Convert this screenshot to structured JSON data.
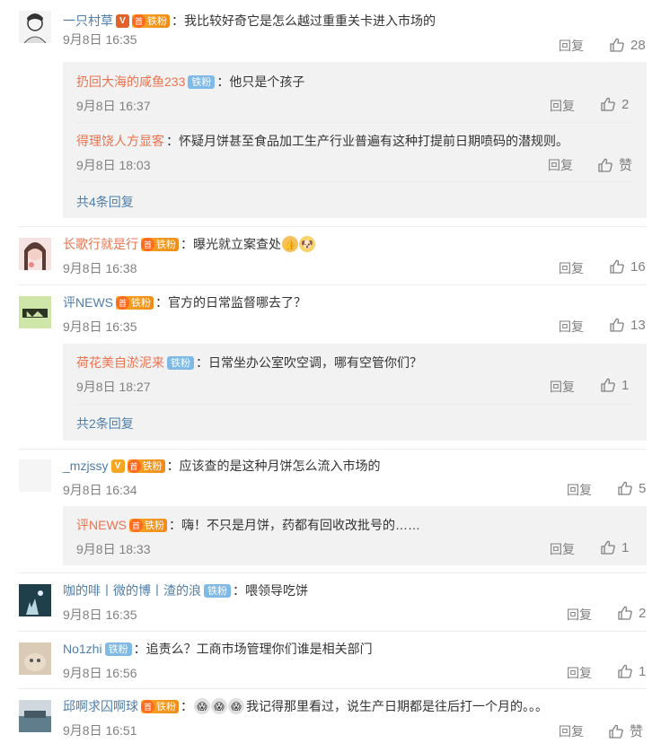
{
  "comments": [
    {
      "user": "一只村草",
      "text": "：我比较好奇它是怎么越过重重关卡进入市场的",
      "time": "9月8日 16:35",
      "reply": "回复",
      "likes": "28",
      "replies": [
        {
          "user": "扔回大海的咸鱼233",
          "badge": "铁粉",
          "text": "：他只是个孩子",
          "time": "9月8日 16:37",
          "reply": "回复",
          "likes": "2"
        },
        {
          "user": "得理饶人方显客",
          "text": "：怀疑月饼甚至食品加工生产行业普遍有这种打提前日期喷码的潜规则。",
          "time": "9月8日 18:03",
          "reply": "回复",
          "likes": "赞"
        }
      ],
      "more": "共4条回复"
    },
    {
      "user": "长歌行就是行",
      "text": "：曝光就立案查处",
      "time": "9月8日 16:38",
      "reply": "回复",
      "likes": "16"
    },
    {
      "user": "评NEWS",
      "text": "：官方的日常监督哪去了？",
      "time": "9月8日 16:35",
      "reply": "回复",
      "likes": "13",
      "replies": [
        {
          "user": "荷花美自淤泥来",
          "badge": "铁粉",
          "text": "：日常坐办公室吹空调，哪有空管你们？",
          "time": "9月8日 18:27",
          "reply": "回复",
          "likes": "1"
        }
      ],
      "more": "共2条回复"
    },
    {
      "user": "_mzjssy",
      "text": "：应该查的是这种月饼怎么流入市场的",
      "time": "9月8日 16:34",
      "reply": "回复",
      "likes": "5",
      "replies": [
        {
          "user": "评NEWS",
          "text": "：嗨！不只是月饼，药都有回收改批号的……",
          "time": "9月8日 18:33",
          "reply": "回复",
          "likes": "1"
        }
      ]
    },
    {
      "user": "咖的啡丨微的博丨渣的浪",
      "badge": "铁粉",
      "text": "：喂领导吃饼",
      "time": "9月8日 16:35",
      "reply": "回复",
      "likes": "2"
    },
    {
      "user": "No1zhi",
      "badge": "铁粉",
      "text": "：追责么？工商市场管理你们谁是相关部门",
      "time": "9月8日 16:56",
      "reply": "回复",
      "likes": "1"
    },
    {
      "user": "邱啊求囚啊球",
      "text": "我记得那里看过，说生产日期都是往后打一个月的。。。",
      "time": "9月8日 16:51",
      "reply": "回复",
      "likes": "赞"
    }
  ],
  "fan_badge": "铁粉",
  "colors": {
    "username": "#eb7350",
    "link": "#4f7ea8",
    "meta": "#808080",
    "reply_bg": "#f2f2f2"
  }
}
